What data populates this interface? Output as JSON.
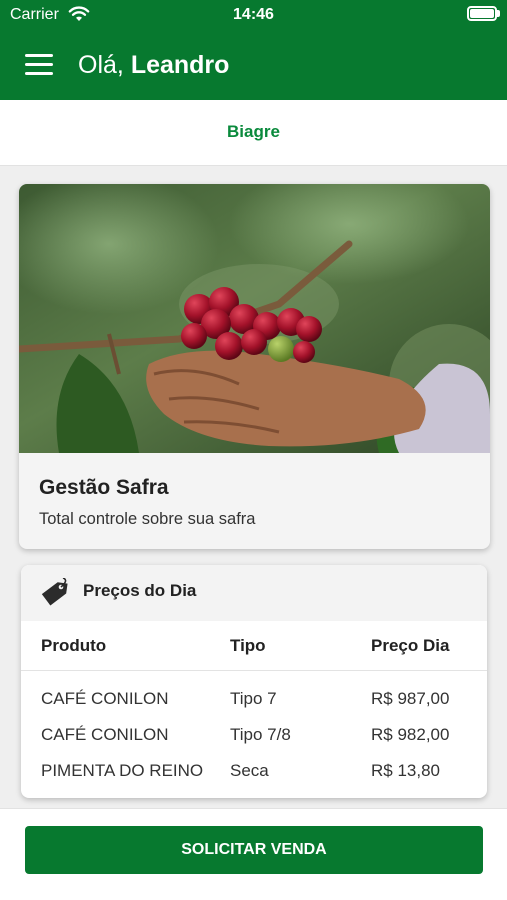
{
  "status_bar": {
    "carrier": "Carrier",
    "time": "14:46"
  },
  "header": {
    "greeting_prefix": "Olá,",
    "user_name": "Leandro",
    "color": "#07792f"
  },
  "company": {
    "name": "Biagre",
    "color": "#0a8a3c"
  },
  "banner": {
    "title": "Gestão Safra",
    "subtitle": "Total controle sobre sua safra",
    "image_subject": "coffee-cherries-in-hand-photo"
  },
  "prices": {
    "title": "Preços do Dia",
    "icon": "price-tag-icon",
    "columns": [
      "Produto",
      "Tipo",
      "Preço Dia"
    ],
    "rows": [
      {
        "produto": "CAFÉ CONILON",
        "tipo": "Tipo 7",
        "preco": "R$ 987,00"
      },
      {
        "produto": "CAFÉ CONILON",
        "tipo": "Tipo 7/8",
        "preco": "R$ 982,00"
      },
      {
        "produto": "PIMENTA DO REINO",
        "tipo": "Seca",
        "preco": "R$ 13,80"
      }
    ]
  },
  "action": {
    "sell_label": "SOLICITAR VENDA"
  }
}
